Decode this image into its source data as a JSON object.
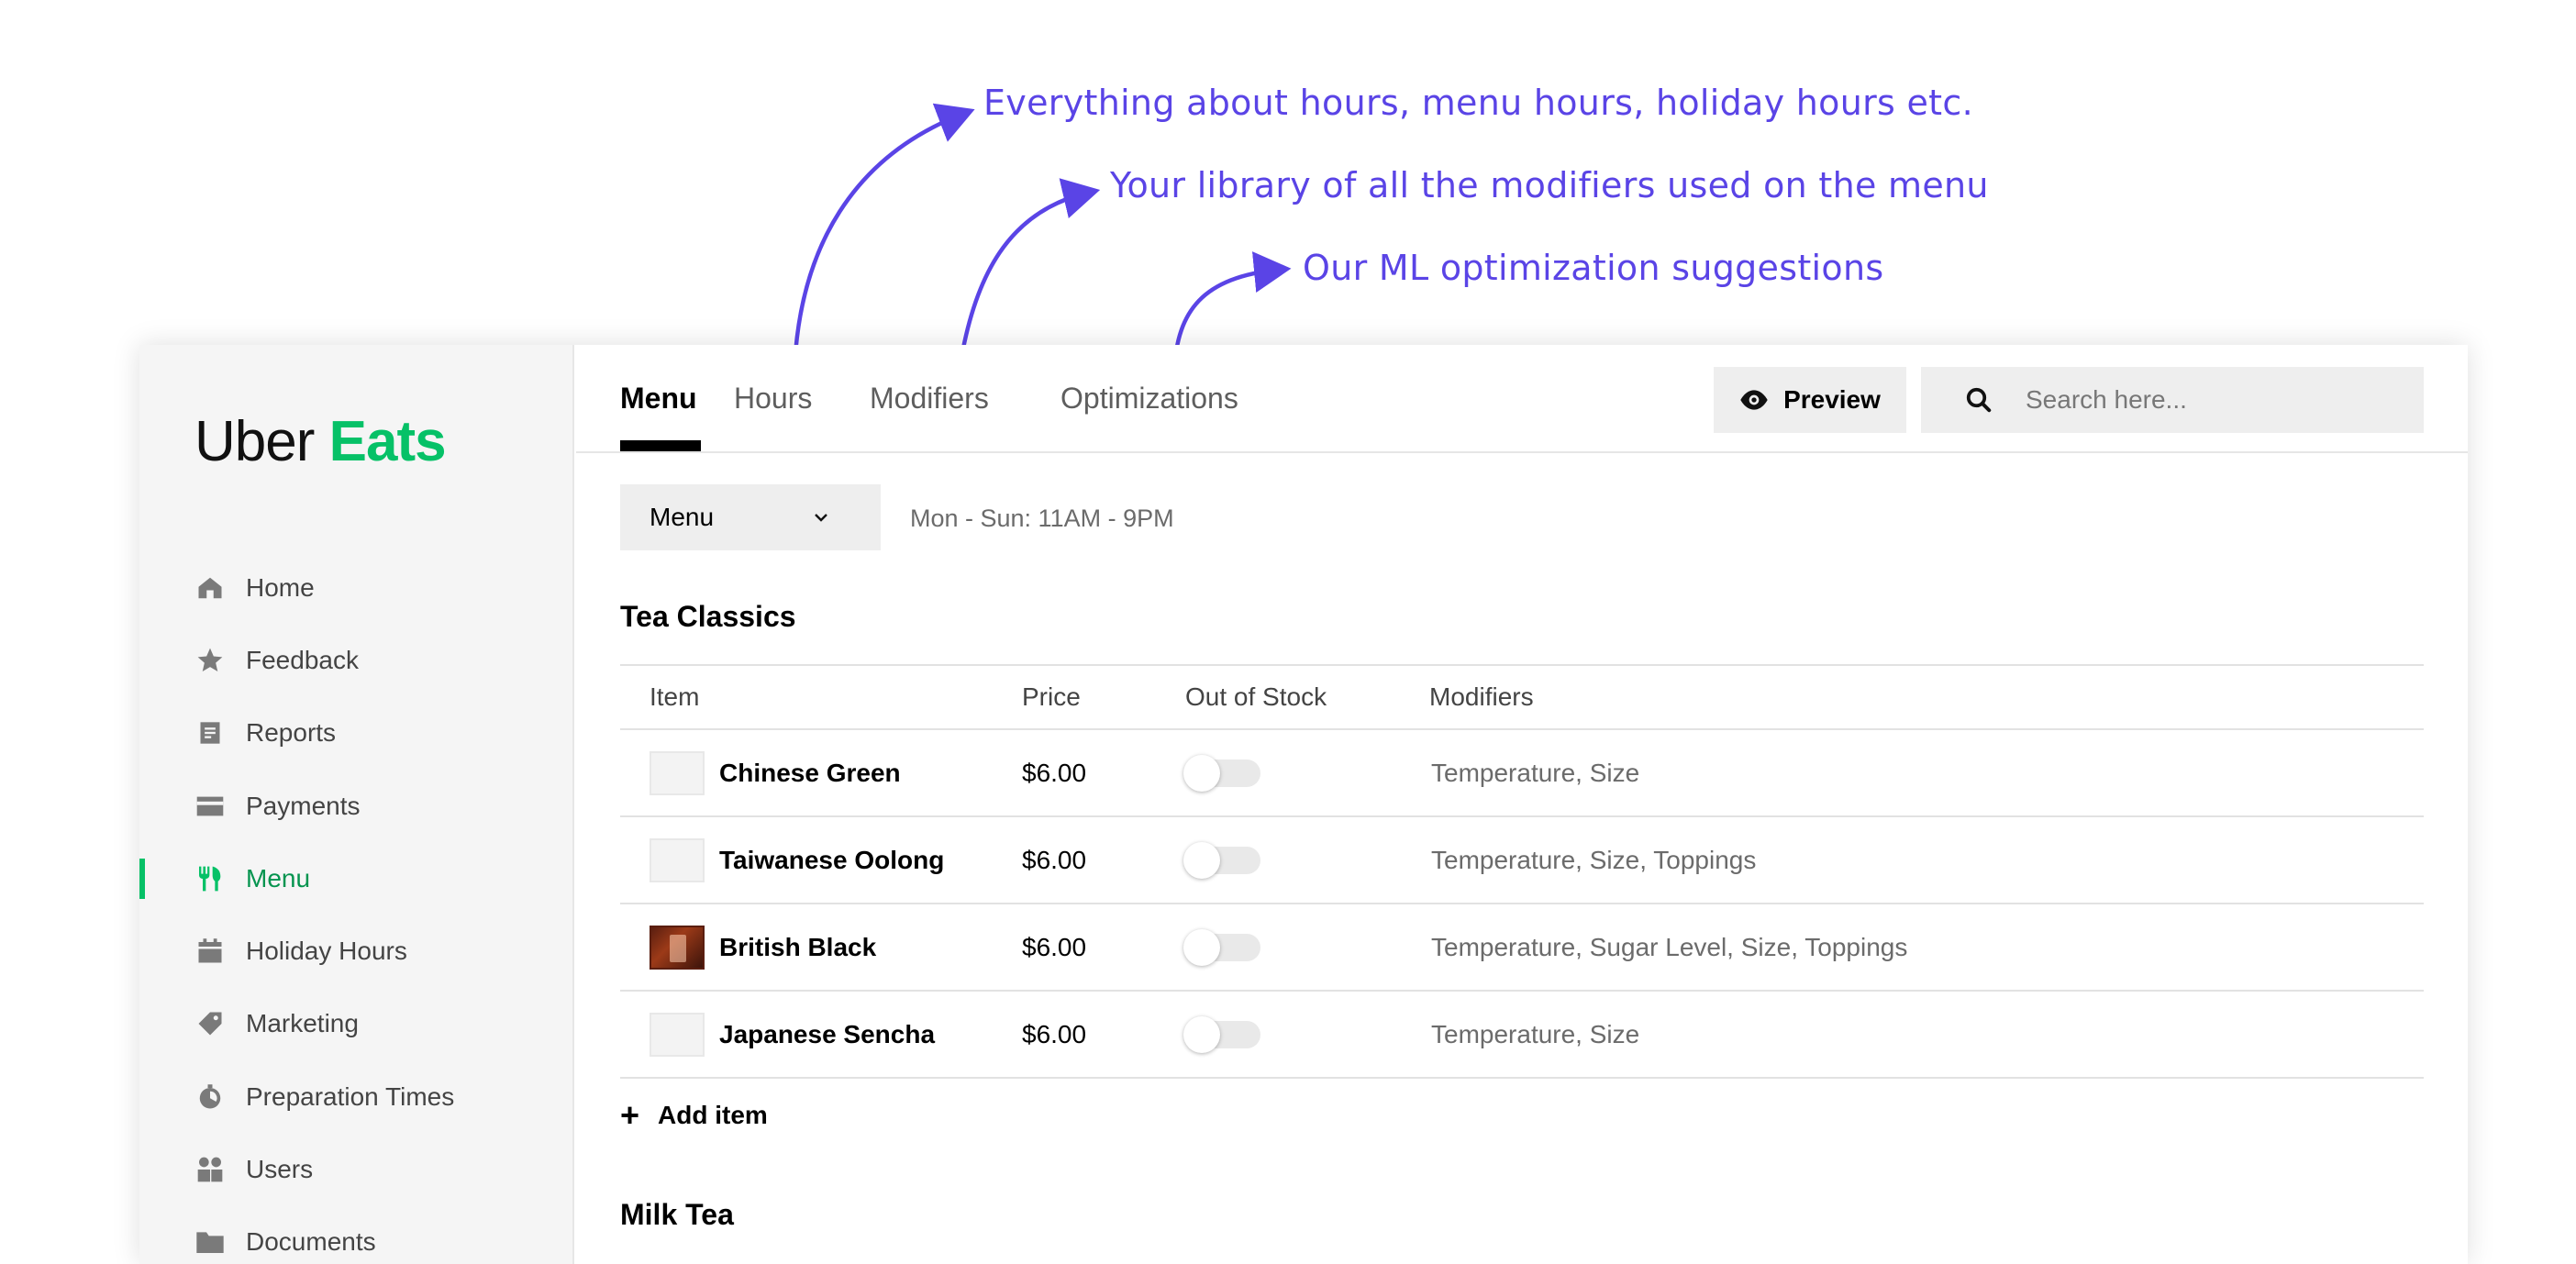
{
  "annotations": {
    "hours_note": "Everything about hours, menu hours, holiday hours etc.",
    "modifiers_note": "Your library of all the modifiers used on the menu",
    "optimizations_note": "Our ML optimization suggestions",
    "color": "#5a44e6"
  },
  "brand": {
    "word1": "Uber",
    "word2": "Eats",
    "accent": "#06c167"
  },
  "sidebar": {
    "items": [
      {
        "label": "Home",
        "icon": "home-icon"
      },
      {
        "label": "Feedback",
        "icon": "star-icon"
      },
      {
        "label": "Reports",
        "icon": "document-icon"
      },
      {
        "label": "Payments",
        "icon": "card-icon"
      },
      {
        "label": "Menu",
        "icon": "utensils-icon",
        "active": true
      },
      {
        "label": "Holiday Hours",
        "icon": "calendar-icon"
      },
      {
        "label": "Marketing",
        "icon": "tag-icon"
      },
      {
        "label": "Preparation Times",
        "icon": "timer-icon"
      },
      {
        "label": "Users",
        "icon": "users-icon"
      },
      {
        "label": "Documents",
        "icon": "folder-icon"
      }
    ]
  },
  "tabs": [
    {
      "label": "Menu",
      "active": true
    },
    {
      "label": "Hours"
    },
    {
      "label": "Modifiers"
    },
    {
      "label": "Optimizations"
    }
  ],
  "toolbar": {
    "preview_label": "Preview",
    "search_placeholder": "Search here..."
  },
  "menu_select": {
    "value": "Menu"
  },
  "hours_text": "Mon - Sun: 11AM - 9PM",
  "sections": [
    {
      "title": "Tea Classics",
      "columns": [
        "Item",
        "Price",
        "Out of Stock",
        "Modifiers"
      ],
      "rows": [
        {
          "name": "Chinese Green",
          "price": "$6.00",
          "out_of_stock": false,
          "modifiers": "Temperature, Size",
          "has_photo": false
        },
        {
          "name": "Taiwanese Oolong",
          "price": "$6.00",
          "out_of_stock": false,
          "modifiers": "Temperature, Size, Toppings",
          "has_photo": false
        },
        {
          "name": "British Black",
          "price": "$6.00",
          "out_of_stock": false,
          "modifiers": "Temperature, Sugar Level, Size, Toppings",
          "has_photo": true
        },
        {
          "name": "Japanese Sencha",
          "price": "$6.00",
          "out_of_stock": false,
          "modifiers": "Temperature, Size",
          "has_photo": false
        }
      ],
      "add_label": "Add item"
    },
    {
      "title": "Milk Tea"
    }
  ]
}
